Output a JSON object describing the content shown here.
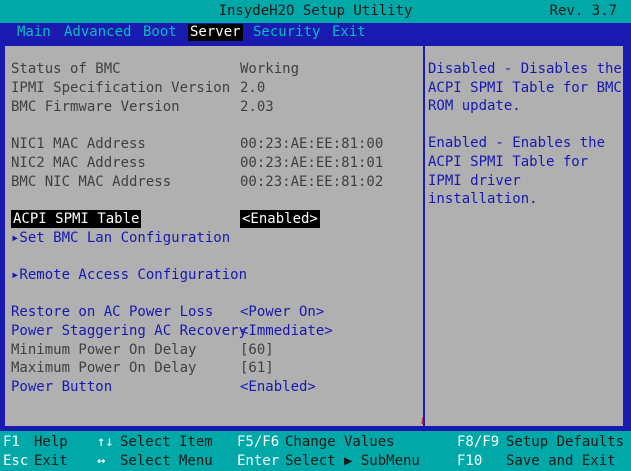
{
  "title": "InsydeH2O Setup Utility",
  "revision": "Rev. 3.7",
  "menu": [
    "Main",
    "Advanced",
    "Boot",
    "Server",
    "Security",
    "Exit"
  ],
  "active_menu": "Server",
  "settings": [
    {
      "label": "Status of BMC",
      "value": "Working",
      "kind": "static"
    },
    {
      "label": "IPMI Specification Version",
      "value": "2.0",
      "kind": "static"
    },
    {
      "label": "BMC Firmware Version",
      "value": "2.03",
      "kind": "static"
    },
    {
      "label": "NIC1 MAC Address",
      "value": "00:23:AE:EE:81:00",
      "kind": "static"
    },
    {
      "label": "NIC2 MAC Address",
      "value": "00:23:AE:EE:81:01",
      "kind": "static"
    },
    {
      "label": "BMC NIC MAC Address",
      "value": "00:23:AE:EE:81:02",
      "kind": "static"
    },
    {
      "label": "ACPI SPMI Table",
      "value": "<Enabled>",
      "kind": "selected"
    },
    {
      "label": "▸Set BMC Lan Configuration",
      "value": "",
      "kind": "submenu"
    },
    {
      "label": "▸Remote Access Configuration",
      "value": "",
      "kind": "submenu"
    },
    {
      "label": "Restore on AC Power Loss",
      "value": "<Power On>",
      "kind": "option"
    },
    {
      "label": "Power Staggering AC Recovery",
      "value": "<Immediate>",
      "kind": "option"
    },
    {
      "label": "Minimum Power On Delay",
      "value": "[60]",
      "kind": "static"
    },
    {
      "label": "Maximum Power On Delay",
      "value": "[61]",
      "kind": "static"
    },
    {
      "label": "Power Button",
      "value": "<Enabled>",
      "kind": "option"
    }
  ],
  "help": {
    "paragraph1": "Disabled - Disables the ACPI SPMI Table for BMC ROM update.",
    "paragraph2": "Enabled - Enables the ACPI SPMI Table for IPMI driver installation."
  },
  "footer": {
    "f1_key": "F1",
    "f1_desc": "Help",
    "esc_key": "Esc",
    "esc_desc": "Exit",
    "updown_key": "↑↓",
    "updown_desc": "Select Item",
    "leftright_key": "↔",
    "leftright_desc": "Select Menu",
    "f5f6_key": "F5/F6",
    "f5f6_desc": "Change Values",
    "enter_key": "Enter",
    "enter_desc": "Select ▶ SubMenu",
    "f8f9_key": "F8/F9",
    "f8f9_desc": "Setup Defaults",
    "f10_key": "F10",
    "f10_desc": "Save and Exit"
  },
  "colors": {
    "background": "#1a1ab0",
    "bar": "#00a8a8",
    "panel": "#b0b0b0",
    "static_text": "#404040",
    "link_text": "#1818b0",
    "menu_text": "#00c0c0"
  }
}
